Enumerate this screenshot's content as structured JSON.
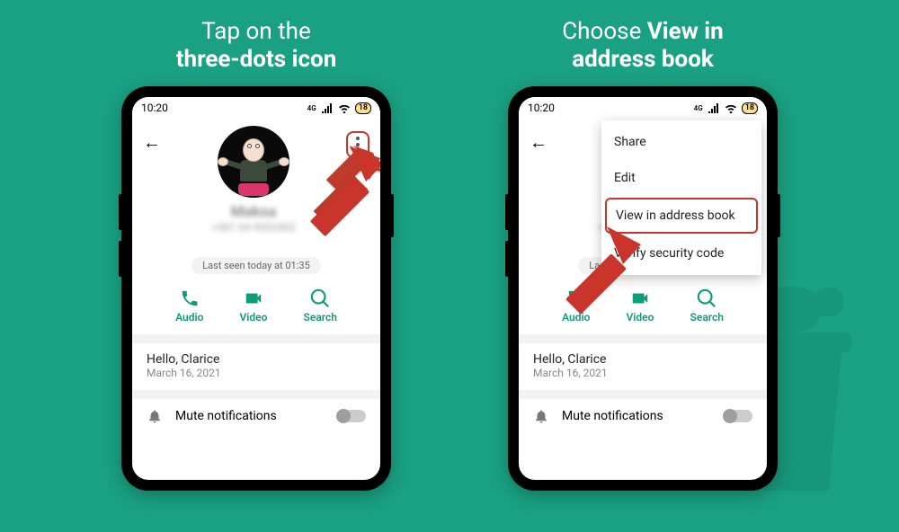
{
  "captions": {
    "left_line1": "Tap on the",
    "left_line2_b": "three-dots icon",
    "right_line1": "Choose ",
    "right_line1_b": "View in",
    "right_line2_b": "address book"
  },
  "statusbar": {
    "time": "10:20",
    "battery": "18"
  },
  "profile": {
    "name": "Maksa",
    "phone": "+381 64 9052402",
    "lastseen": "Last seen today at 01:35"
  },
  "actions": {
    "audio": "Audio",
    "video": "Video",
    "search": "Search"
  },
  "about": {
    "text": "Hello, Clarice",
    "date": "March 16, 2021"
  },
  "mute": {
    "label": "Mute notifications"
  },
  "menu": {
    "share": "Share",
    "edit": "Edit",
    "view": "View in address book",
    "verify": "Verify security code"
  }
}
